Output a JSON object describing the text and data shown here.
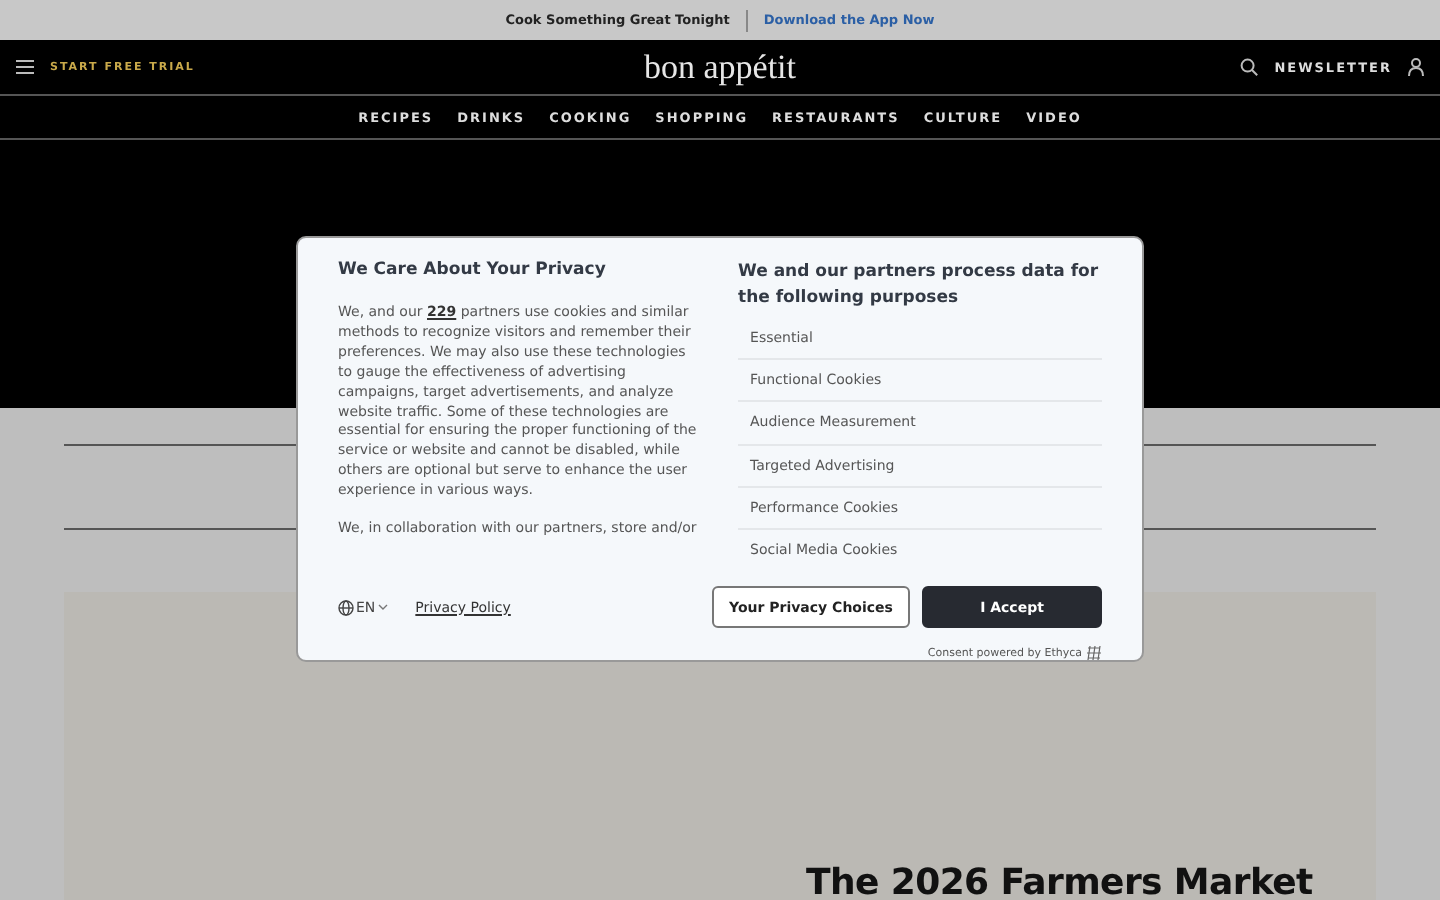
{
  "promo_bar": {
    "text": "Cook Something Great Tonight",
    "link": "Download the App Now"
  },
  "header": {
    "trial": "START FREE TRIAL",
    "logo": "bon appétit",
    "newsletter": "NEWSLETTER"
  },
  "nav": [
    "RECIPES",
    "DRINKS",
    "COOKING",
    "SHOPPING",
    "RESTAURANTS",
    "CULTURE",
    "VIDEO"
  ],
  "consent": {
    "title": "We Care About Your Privacy",
    "intro_before": "We, and our",
    "intro_link": "229",
    "intro_after": "partners use cookies and similar methods to recognize visitors and remember their preferences. We may also use these technologies to gauge the effectiveness of advertising campaigns, target advertisements, and analyze website traffic. Some of these technologies are essential for ensuring the proper functioning of the service or website and cannot be disabled, while others are optional but serve to enhance the user experience in various ways.",
    "more": "We, in collaboration with our partners, store and/or",
    "purposes_title": "We and our partners process data for the following purposes",
    "purposes": [
      "Essential",
      "Functional Cookies",
      "Audience Measurement",
      "Targeted Advertising",
      "Performance Cookies",
      "Social Media Cookies"
    ],
    "language": "EN",
    "privacy_policy": "Privacy Policy",
    "buttons": [
      {
        "label": "Your Privacy Choices",
        "kind": "secondary"
      },
      {
        "label": "I Accept",
        "kind": "primary"
      }
    ],
    "powered_by": "Consent powered by Ethyca"
  },
  "article": {
    "title": "The 2026 Farmers Market"
  }
}
